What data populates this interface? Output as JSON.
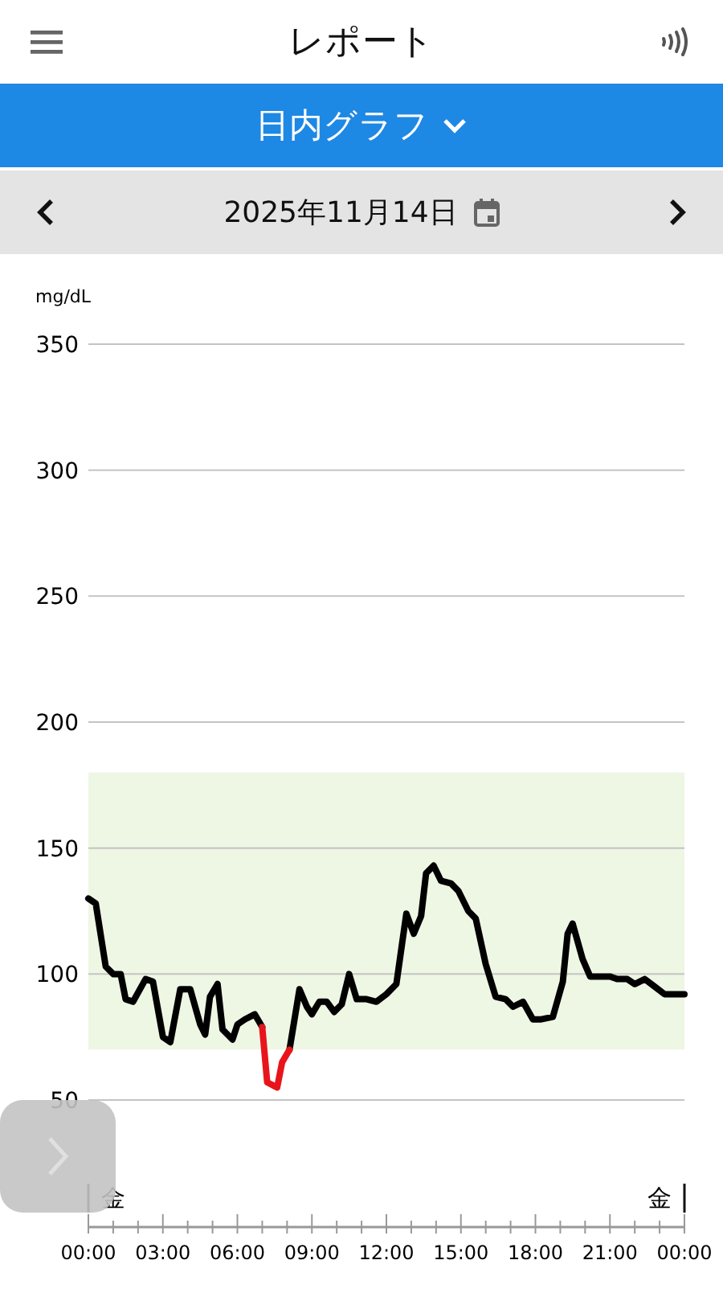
{
  "header": {
    "title": "レポート"
  },
  "view_selector": {
    "label": "日内グラフ"
  },
  "date_bar": {
    "date": "2025年11月14日"
  },
  "chart": {
    "day_markers": [
      "金",
      "金"
    ],
    "chart_data": {
      "type": "line",
      "ylabel": "mg/dL",
      "x": [
        0,
        0.3,
        0.7,
        1.0,
        1.3,
        1.5,
        1.8,
        2.3,
        2.6,
        3.0,
        3.3,
        3.7,
        4.1,
        4.5,
        4.7,
        4.9,
        5.2,
        5.4,
        5.8,
        6.0,
        6.3,
        6.7,
        7.0,
        7.2,
        7.6,
        7.8,
        8.1,
        8.5,
        8.8,
        9.0,
        9.3,
        9.6,
        9.9,
        10.2,
        10.5,
        10.8,
        11.2,
        11.6,
        12.0,
        12.4,
        12.8,
        13.1,
        13.4,
        13.6,
        13.9,
        14.2,
        14.6,
        14.9,
        15.3,
        15.6,
        16.0,
        16.4,
        16.8,
        17.1,
        17.5,
        17.9,
        18.2,
        18.7,
        19.1,
        19.3,
        19.5,
        19.9,
        20.2,
        20.6,
        21.0,
        21.3,
        21.7,
        22.0,
        22.4,
        22.8,
        23.2,
        23.6,
        24.0
      ],
      "series": [
        {
          "color": "#000000",
          "values": [
            130,
            128,
            103,
            100,
            100,
            90,
            89,
            98,
            97,
            75,
            73,
            94,
            94,
            80,
            76,
            91,
            96,
            78,
            74,
            80,
            82,
            84,
            79,
            null,
            null,
            null,
            70,
            94,
            87,
            84,
            89,
            89,
            85,
            88,
            100,
            90,
            90,
            89,
            92,
            96,
            124,
            116,
            123,
            140,
            143,
            137,
            136,
            133,
            125,
            122,
            104,
            91,
            90,
            87,
            89,
            82,
            82,
            83,
            97,
            116,
            120,
            106,
            99,
            99,
            99,
            98,
            98,
            96,
            98,
            95,
            92,
            92,
            92
          ]
        },
        {
          "color": "#e8141b",
          "values": [
            null,
            null,
            null,
            null,
            null,
            null,
            null,
            null,
            null,
            null,
            null,
            null,
            null,
            null,
            null,
            null,
            null,
            null,
            null,
            null,
            null,
            null,
            79,
            57,
            55,
            65,
            70,
            null,
            null,
            null,
            null,
            null,
            null,
            null,
            null,
            null,
            null,
            null,
            null,
            null,
            null,
            null,
            null,
            null,
            null,
            null,
            null,
            null,
            null,
            null,
            null,
            null,
            null,
            null,
            null,
            null,
            null,
            null,
            null,
            null,
            null,
            null,
            null,
            null,
            null,
            null,
            null,
            null,
            null,
            null,
            null,
            null,
            null
          ]
        }
      ],
      "xlim": [
        0,
        24
      ],
      "ylim": [
        50,
        350
      ],
      "xticks": [
        {
          "value": 0,
          "label": "00:00"
        },
        {
          "value": 3,
          "label": "03:00"
        },
        {
          "value": 6,
          "label": "06:00"
        },
        {
          "value": 9,
          "label": "09:00"
        },
        {
          "value": 12,
          "label": "12:00"
        },
        {
          "value": 15,
          "label": "15:00"
        },
        {
          "value": 18,
          "label": "18:00"
        },
        {
          "value": 21,
          "label": "21:00"
        },
        {
          "value": 24,
          "label": "00:00"
        }
      ],
      "yticks": [
        50,
        100,
        150,
        200,
        250,
        300,
        350
      ],
      "grid": true,
      "bands": [
        {
          "axis": "y",
          "from": 70,
          "to": 180,
          "color": "#eef6e4"
        }
      ]
    }
  }
}
